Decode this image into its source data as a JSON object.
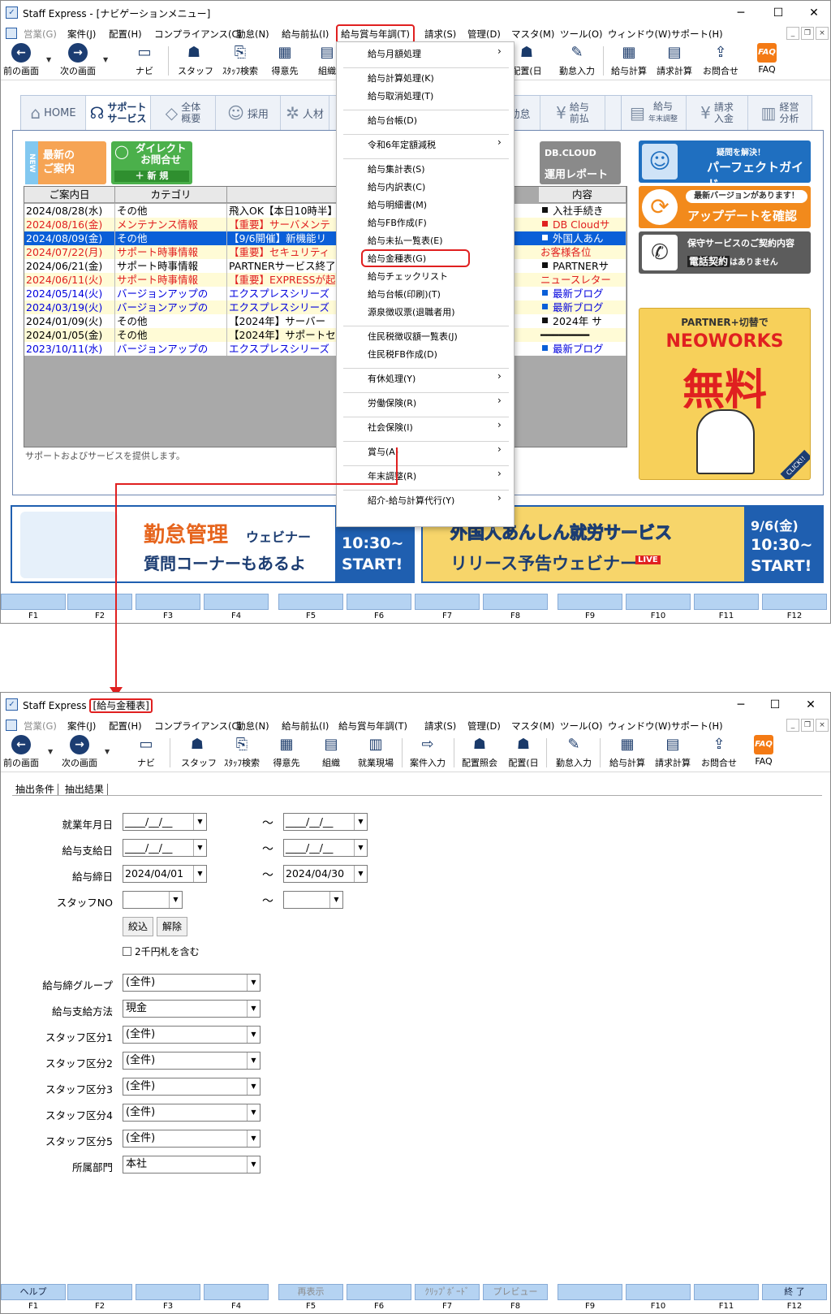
{
  "top_window": {
    "title": "Staff Express - [ナビゲーションメニュー]",
    "menus": [
      "営業(G)",
      "案件(J)",
      "配置(H)",
      "コンプライアンス(C)",
      "勤怠(N)",
      "給与前払(I)",
      "給与賞与年調(T)",
      "請求(S)",
      "管理(D)",
      "マスタ(M)",
      "ツール(O)",
      "ウィンドウ(W)",
      "サポート(H)"
    ],
    "toolbar": [
      "前の画面",
      "次の画面",
      "ナビ",
      "スタッフ",
      "ｽﾀｯﾌ検索",
      "得意先",
      "組織",
      "配置(日",
      "勤怠入力",
      "給与計算",
      "請求計算",
      "お問合せ",
      "FAQ"
    ],
    "nav_tabs": [
      "HOME",
      "サポート",
      "サービス",
      "全体",
      "概要",
      "採用",
      "人材",
      "勤怠",
      "給与",
      "前払",
      "給与",
      "年末調整",
      "請求",
      "入金",
      "経営",
      "分析"
    ],
    "latest_info": [
      "NEW",
      "最新の",
      "ご案内"
    ],
    "direct_inquiry": [
      "ダイレクト",
      "お問合せ",
      "＋ 新 規"
    ],
    "db_cloud": [
      "DB.CLOUD",
      "運用レポート"
    ],
    "news_headers": [
      "ご案内日",
      "カテゴリ",
      "内容"
    ],
    "news": [
      {
        "date": "2024/08/28(水)",
        "cat": "その他",
        "title": "飛入OK【本日10時半】",
        "content": "入社手続き"
      },
      {
        "date": "2024/08/16(金)",
        "cat": "メンテナンス情報",
        "title": "【重要】サーバメンテ",
        "content": "DB Cloudサ"
      },
      {
        "date": "2024/08/09(金)",
        "cat": "その他",
        "title": "【9/6開催】新機能リ",
        "content": "外国人あん"
      },
      {
        "date": "2024/07/22(月)",
        "cat": "サポート時事情報",
        "title": "【重要】セキュリティ",
        "content": "お客様各位"
      },
      {
        "date": "2024/06/21(金)",
        "cat": "サポート時事情報",
        "title": "PARTNERサービス終了",
        "content": "PARTNERサ"
      },
      {
        "date": "2024/06/11(火)",
        "cat": "サポート時事情報",
        "title": "【重要】EXPRESSが起",
        "content": "ニュースレター"
      },
      {
        "date": "2024/05/14(火)",
        "cat": "バージョンアップの",
        "title": "エクスプレスシリーズ",
        "content": "最新ブログ"
      },
      {
        "date": "2024/03/19(火)",
        "cat": "バージョンアップの",
        "title": "エクスプレスシリーズ",
        "content": "最新ブログ"
      },
      {
        "date": "2024/01/09(火)",
        "cat": "その他",
        "title": "【2024年】サーバー",
        "content": "2024年 サ"
      },
      {
        "date": "2024/01/05(金)",
        "cat": "その他",
        "title": "【2024年】サポートセ",
        "content": "━━━━━━━━"
      },
      {
        "date": "2023/10/11(水)",
        "cat": "バージョンアップの",
        "title": "エクスプレスシリーズ",
        "content": "最新ブログ"
      }
    ],
    "footnote": "サポートおよびサービスを提供します。",
    "side_banners": [
      {
        "sub": "疑問を解決！",
        "main": "パーフェクトガイド"
      },
      {
        "sub": "最新バージョンがあります！",
        "main": "アップデートを確認"
      },
      {
        "sub": "保守サービスのご契約内容",
        "main": "電話契約",
        "tail": "はありません"
      }
    ],
    "neoworks": {
      "top": "PARTNER+切替で",
      "brand": "NEOWORKS",
      "big": "無料",
      "corner": "CLICK!!"
    },
    "banner_left": {
      "title": "勤怠管理",
      "title2": "ウェビナー",
      "sub": "質問コーナーもあるよ",
      "time": "10:30~",
      "start": "START!"
    },
    "banner_right": {
      "title": "外国人あんしん就労サービス",
      "sub": "リリース予告ウェビナー",
      "live": "LIVE",
      "date": "9/6(金)",
      "time": "10:30~",
      "start": "START!"
    },
    "dropdown": [
      {
        "label": "給与月額処理",
        "arrow": true
      },
      {
        "label": "給与計算処理(K)"
      },
      {
        "label": "給与取消処理(T)"
      },
      {
        "label": "給与台帳(D)"
      },
      {
        "label": "令和6年定額減税",
        "arrow": true
      },
      {
        "label": "給与集計表(S)"
      },
      {
        "label": "給与内訳表(C)"
      },
      {
        "label": "給与明細書(M)"
      },
      {
        "label": "給与FB作成(F)"
      },
      {
        "label": "給与未払一覧表(E)"
      },
      {
        "label": "給与金種表(G)"
      },
      {
        "label": "給与チェックリスト"
      },
      {
        "label": "給与台帳(印刷)(T)"
      },
      {
        "label": "源泉徴収票(退職者用)"
      },
      {
        "label": "住民税徴収額一覧表(J)"
      },
      {
        "label": "住民税FB作成(D)"
      },
      {
        "label": "有休処理(Y)",
        "arrow": true
      },
      {
        "label": "労働保険(R)",
        "arrow": true
      },
      {
        "label": "社会保険(I)",
        "arrow": true
      },
      {
        "label": "賞与(A)",
        "arrow": true
      },
      {
        "label": "年末調整(R)",
        "arrow": true
      },
      {
        "label": "紹介-給与計算代行(Y)",
        "arrow": true
      }
    ],
    "fkeys": [
      "",
      "",
      "",
      "",
      "",
      "",
      "",
      "",
      "",
      "",
      "",
      ""
    ],
    "flabels": [
      "F1",
      "F2",
      "F3",
      "F4",
      "F5",
      "F6",
      "F7",
      "F8",
      "F9",
      "F10",
      "F11",
      "F12"
    ]
  },
  "bottom_window": {
    "title_prefix": "Staff Express",
    "title_hl": "[給与金種表]",
    "menus": [
      "営業(G)",
      "案件(J)",
      "配置(H)",
      "コンプライアンス(C)",
      "勤怠(N)",
      "給与前払(I)",
      "給与賞与年調(T)",
      "請求(S)",
      "管理(D)",
      "マスタ(M)",
      "ツール(O)",
      "ウィンドウ(W)",
      "サポート(H)"
    ],
    "toolbar": [
      "前の画面",
      "次の画面",
      "ナビ",
      "スタッフ",
      "ｽﾀｯﾌ検索",
      "得意先",
      "組織",
      "就業現場",
      "案件入力",
      "配置照会",
      "配置(日",
      "勤怠入力",
      "給与計算",
      "請求計算",
      "お問合せ",
      "FAQ"
    ],
    "tabs": [
      "抽出条件",
      "抽出結果"
    ],
    "form": {
      "work_ym": {
        "label": "就業年月日",
        "from": "____/__/__",
        "to": "____/__/__"
      },
      "pay_date": {
        "label": "給与支給日",
        "from": "____/__/__",
        "to": "____/__/__"
      },
      "close_date": {
        "label": "給与締日",
        "from": "2024/04/01",
        "to": "2024/04/30"
      },
      "staff_no": {
        "label": "スタッフNO",
        "from": "",
        "to": ""
      },
      "filter_btn": "絞込",
      "clear_btn": "解除",
      "checkbox": "2千円札を含む",
      "selects": [
        {
          "label": "給与締グループ",
          "value": "(全件)"
        },
        {
          "label": "給与支給方法",
          "value": "現金"
        },
        {
          "label": "スタッフ区分1",
          "value": "(全件)"
        },
        {
          "label": "スタッフ区分2",
          "value": "(全件)"
        },
        {
          "label": "スタッフ区分3",
          "value": "(全件)"
        },
        {
          "label": "スタッフ区分4",
          "value": "(全件)"
        },
        {
          "label": "スタッフ区分5",
          "value": "(全件)"
        },
        {
          "label": "所属部門",
          "value": "本社"
        }
      ]
    },
    "fkeys": [
      "ヘルプ",
      "",
      "",
      "",
      "再表示",
      "",
      "ｸﾘｯﾌﾟﾎﾞｰﾄﾞ",
      "プレビュー",
      "",
      "",
      "",
      "終 了"
    ],
    "flabels": [
      "F1",
      "F2",
      "F3",
      "F4",
      "F5",
      "F6",
      "F7",
      "F8",
      "F9",
      "F10",
      "F11",
      "F12"
    ]
  },
  "colors": {
    "accent_red": "#e02020",
    "blue_select": "#0a5fd8",
    "fkey": "#b5d3f2",
    "navy": "#1c3d72"
  }
}
